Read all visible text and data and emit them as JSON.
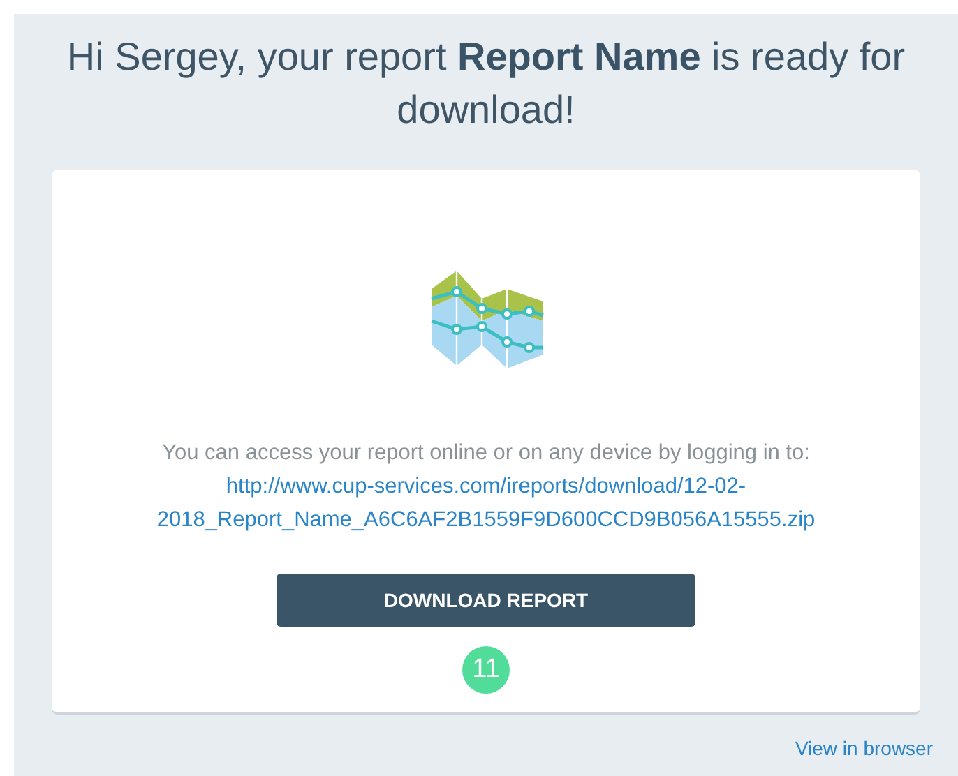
{
  "heading": "Hi Sergey, your report **Report Name** is ready for download!",
  "card": {
    "message": "You can access your report online or on any device by logging in to:",
    "link": "http://www.cup-services.com/ireports/download/12-02-2018_Report_Name_A6C6AF2B1559F9D600CCD9B056A15555.zip",
    "button": "DOWNLOAD REPORT",
    "badge": "11"
  },
  "footer_link": "View in browser"
}
